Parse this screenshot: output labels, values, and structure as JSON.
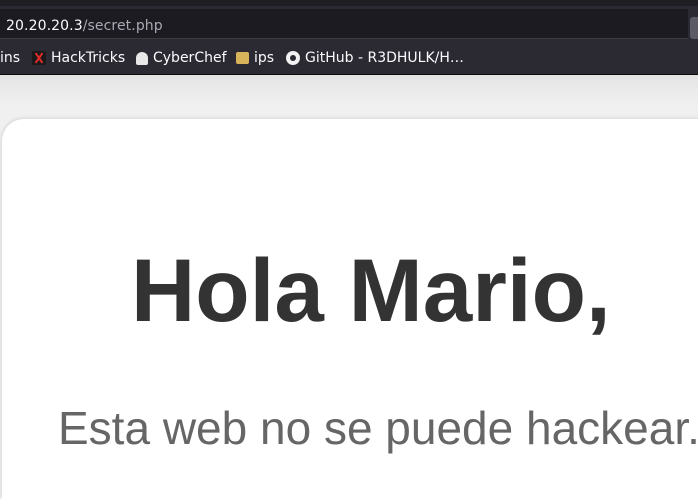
{
  "browser": {
    "url_host": "20.20.20.3",
    "url_path": "/secret.php",
    "bookmarks": [
      {
        "label": "ins",
        "icon": "none"
      },
      {
        "label": "HackTricks",
        "icon": "hacktricks-icon"
      },
      {
        "label": "CyberChef",
        "icon": "cyberchef-icon"
      },
      {
        "label": "ips",
        "icon": "folder-tag-icon"
      },
      {
        "label": "GitHub - R3DHULK/H…",
        "icon": "github-icon"
      }
    ]
  },
  "page": {
    "greeting": "Hola Mario,",
    "tagline": "Esta web no se puede hackear."
  },
  "colors": {
    "toolbar": "#2b2a33",
    "url_field": "#1c1b22",
    "heading_text": "#333333",
    "tagline_text": "#666666",
    "page_background": "#f0f0f0",
    "card_background": "#ffffff"
  }
}
